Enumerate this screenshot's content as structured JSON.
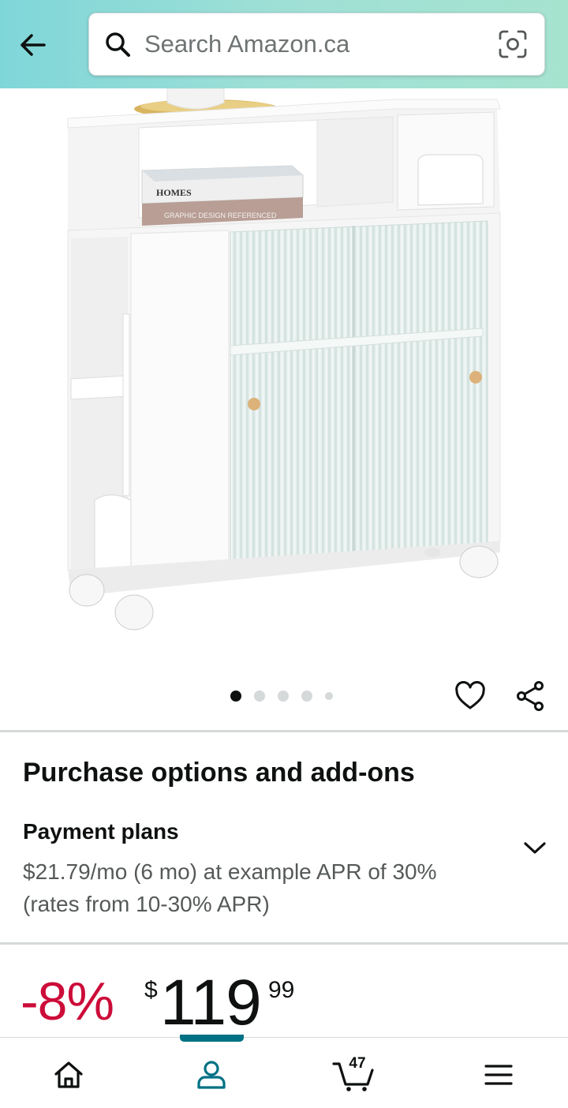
{
  "header": {
    "search_placeholder": "Search Amazon.ca"
  },
  "carousel": {
    "image_count": 5,
    "active_index": 0
  },
  "purchase_options": {
    "title": "Purchase options and add-ons",
    "payment_plans": {
      "title": "Payment plans",
      "description": "$21.79/mo (6 mo) at example APR of 30% (rates from 10-30% APR)"
    }
  },
  "price": {
    "discount": "-8%",
    "currency": "$",
    "whole": "119",
    "fraction": "99"
  },
  "bottom_nav": {
    "items": [
      "home-icon",
      "you-icon",
      "cart-icon",
      "menu-icon"
    ],
    "active": "you",
    "cart_count": "47"
  },
  "colors": {
    "header_gradient_start": "#7fd6d9",
    "header_gradient_end": "#a6e3cf",
    "discount": "#cc0c39",
    "accent": "#007185",
    "text": "#0f1111",
    "secondary_text": "#565959"
  }
}
